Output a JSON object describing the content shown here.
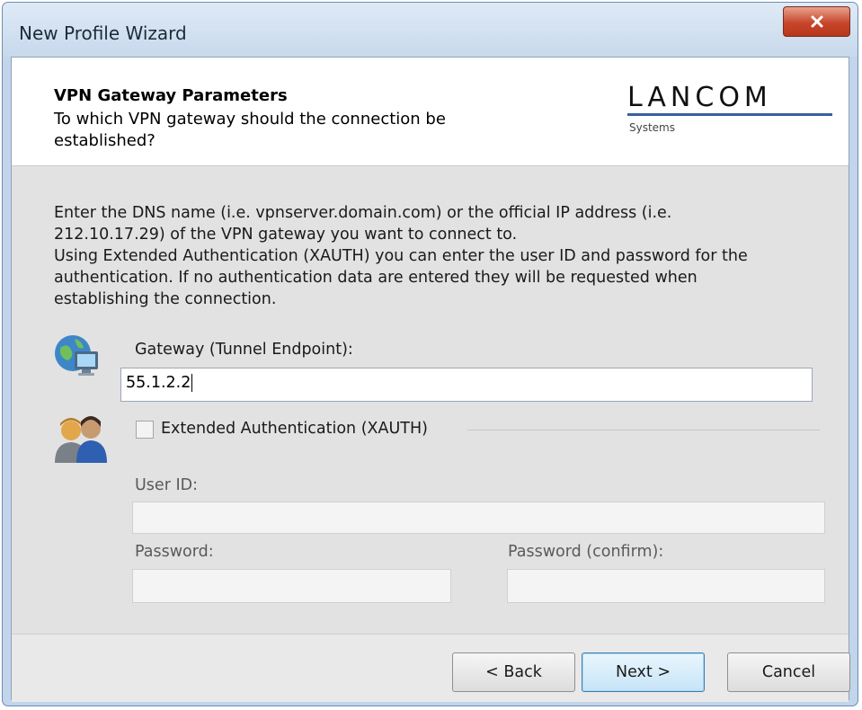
{
  "window": {
    "title": "New Profile Wizard",
    "close_glyph": "x"
  },
  "header": {
    "title": "VPN Gateway Parameters",
    "subtitle": "To which VPN gateway should the connection be established?",
    "logo": {
      "name": "LANCOM",
      "tagline": "Systems",
      "accent_color": "#3a5f9e"
    }
  },
  "description_lines": [
    "Enter the DNS name (i.e. vpnserver.domain.com) or the official IP address (i.e.",
    "212.10.17.29) of the VPN gateway you want to connect to.",
    "Using Extended Authentication (XAUTH) you can enter the user ID and password for the",
    "authentication. If no authentication data are entered they will be requested when",
    "establishing the connection."
  ],
  "gateway": {
    "icon": "globe-computer-icon",
    "label": "Gateway (Tunnel Endpoint):",
    "value": "55.1.2.2"
  },
  "xauth": {
    "icon": "users-icon",
    "checkbox_label": "Extended Authentication (XAUTH)",
    "checked": false,
    "user_id_label": "User ID:",
    "user_id_value": "",
    "password_label": "Password:",
    "password_value": "",
    "password_confirm_label": "Password (confirm):",
    "password_confirm_value": ""
  },
  "buttons": {
    "back": "< Back",
    "next": "Next >",
    "cancel": "Cancel"
  }
}
